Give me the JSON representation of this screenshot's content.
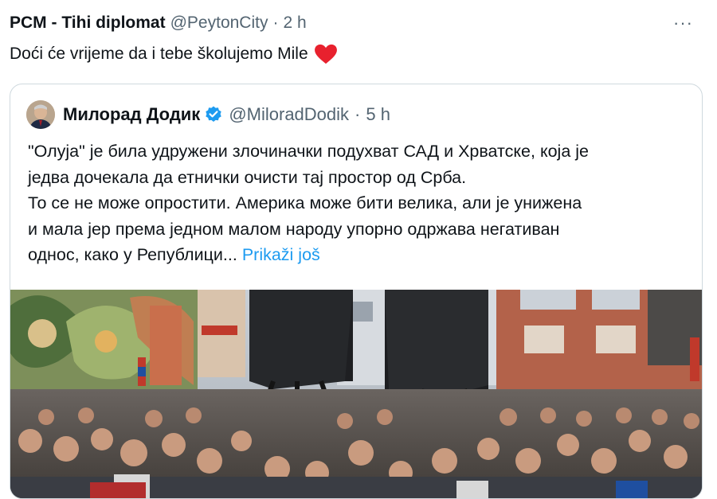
{
  "tweet": {
    "author_name": "PCM - Tihi diplomat",
    "author_handle": "@PeytonCity",
    "separator": "·",
    "time": "2 h",
    "more_icon": "···",
    "text": "Doći će vrijeme da i tebe školujemo Mile",
    "heart_color": "#e8212e"
  },
  "quote": {
    "author_name": "Милорад Додик",
    "author_handle": "@MiloradDodik",
    "separator": "·",
    "time": "5 h",
    "verified_color": "#1d9bf0",
    "lines": [
      "\"Олуја\" је била удружени злочиначки подухват САД и Хрватске, која је",
      "једва дочекала да етнички очисти тај простор од Срба.",
      "То се не може опростити. Америка може бити велика, али је унижена",
      "и мала јер према једном малом народу упорно одржава негативан",
      "однос, како у Републици..."
    ],
    "show_more": "Prikaži još",
    "show_more_color": "#1d9bf0"
  }
}
